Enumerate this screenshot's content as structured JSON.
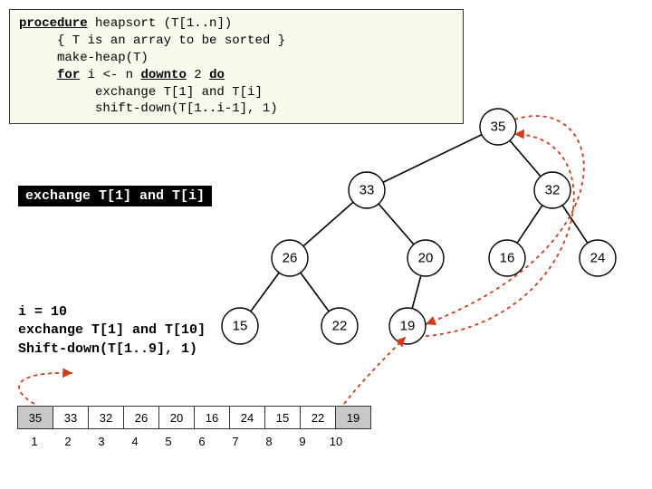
{
  "code": {
    "l1a": "procedure",
    "l1b": " heapsort (T[1..n])",
    "l2": "     { T is an array to be sorted }",
    "l3": "     make-heap(T)",
    "l4a": "     ",
    "l4b": "for",
    "l4c": " i <- n ",
    "l4d": "downto",
    "l4e": " 2 ",
    "l4f": "do",
    "l5": "          exchange T[1] and T[i]",
    "l6": "          shift-down(T[1..i-1], 1)"
  },
  "exchange_label": "exchange T[1] and T[i]",
  "step": {
    "l1": "i = 10",
    "l2": "exchange T[1] and T[10]",
    "l3": "Shift-down(T[1..9], 1)"
  },
  "tree": {
    "n1": "35",
    "n2": "33",
    "n3": "32",
    "n4": "26",
    "n5": "20",
    "n6": "16",
    "n7": "24",
    "n8": "15",
    "n9": "22",
    "n10": "19"
  },
  "array": {
    "values": {
      "v1": "35",
      "v2": "33",
      "v3": "32",
      "v4": "26",
      "v5": "20",
      "v6": "16",
      "v7": "24",
      "v8": "15",
      "v9": "22",
      "v10": "19"
    },
    "index": {
      "i1": "1",
      "i2": "2",
      "i3": "3",
      "i4": "4",
      "i5": "5",
      "i6": "6",
      "i7": "7",
      "i8": "8",
      "i9": "9",
      "i10": "10"
    }
  }
}
